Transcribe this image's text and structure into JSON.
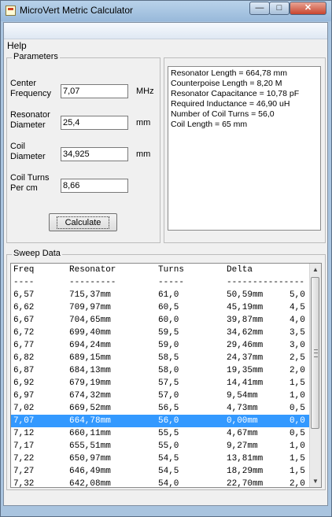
{
  "window": {
    "title": "MicroVert Metric Calculator",
    "minimize_label": "—",
    "maximize_label": "□",
    "close_label": "✕"
  },
  "menu": {
    "help_label": "Help"
  },
  "parameters": {
    "title": "Parameters",
    "center_frequency": {
      "label_1": "Center",
      "label_2": "Frequency",
      "value": "7,07",
      "unit": "MHz"
    },
    "resonator_diameter": {
      "label_1": "Resonator",
      "label_2": "Diameter",
      "value": "25,4",
      "unit": "mm"
    },
    "coil_diameter": {
      "label_1": "Coil",
      "label_2": "Diameter",
      "value": "34,925",
      "unit": "mm"
    },
    "coil_turns": {
      "label_1": "Coil Turns",
      "label_2": "Per cm",
      "value": "8,66"
    },
    "calculate_label": "Calculate"
  },
  "results": {
    "lines": [
      "Resonator Length = 664,78 mm",
      "Counterpoise Length = 8,20 M",
      "Resonator Capacitance = 10,78 pF",
      "Required Inductance = 46,90 uH",
      "Number of Coil Turns = 56,0",
      "Coil Length = 65 mm"
    ]
  },
  "sweep": {
    "title": "Sweep Data",
    "header": [
      "Freq",
      "Resonator",
      "Turns",
      "Delta",
      ""
    ],
    "separator": [
      "----",
      "---------",
      "-----",
      "---------------",
      ""
    ],
    "selected_freq": "7,07",
    "rows": [
      [
        "6,57",
        "715,37mm",
        "61,0",
        "50,59mm",
        "5,0"
      ],
      [
        "6,62",
        "709,97mm",
        "60,5",
        "45,19mm",
        "4,5"
      ],
      [
        "6,67",
        "704,65mm",
        "60,0",
        "39,87mm",
        "4,0"
      ],
      [
        "6,72",
        "699,40mm",
        "59,5",
        "34,62mm",
        "3,5"
      ],
      [
        "6,77",
        "694,24mm",
        "59,0",
        "29,46mm",
        "3,0"
      ],
      [
        "6,82",
        "689,15mm",
        "58,5",
        "24,37mm",
        "2,5"
      ],
      [
        "6,87",
        "684,13mm",
        "58,0",
        "19,35mm",
        "2,0"
      ],
      [
        "6,92",
        "679,19mm",
        "57,5",
        "14,41mm",
        "1,5"
      ],
      [
        "6,97",
        "674,32mm",
        "57,0",
        "9,54mm",
        "1,0 T"
      ],
      [
        "7,02",
        "669,52mm",
        "56,5",
        "4,73mm",
        "0,5 T"
      ],
      [
        "7,07",
        "664,78mm",
        "56,0",
        "0,00mm",
        "0,0 T"
      ],
      [
        "7,12",
        "660,11mm",
        "55,5",
        "4,67mm",
        "0,5 T"
      ],
      [
        "7,17",
        "655,51mm",
        "55,0",
        "9,27mm",
        "1,0 T"
      ],
      [
        "7,22",
        "650,97mm",
        "54,5",
        "13,81mm",
        "1,5"
      ],
      [
        "7,27",
        "646,49mm",
        "54,5",
        "18,29mm",
        "1,5"
      ],
      [
        "7,32",
        "642,08mm",
        "54,0",
        "22,70mm",
        "2,0"
      ]
    ]
  }
}
